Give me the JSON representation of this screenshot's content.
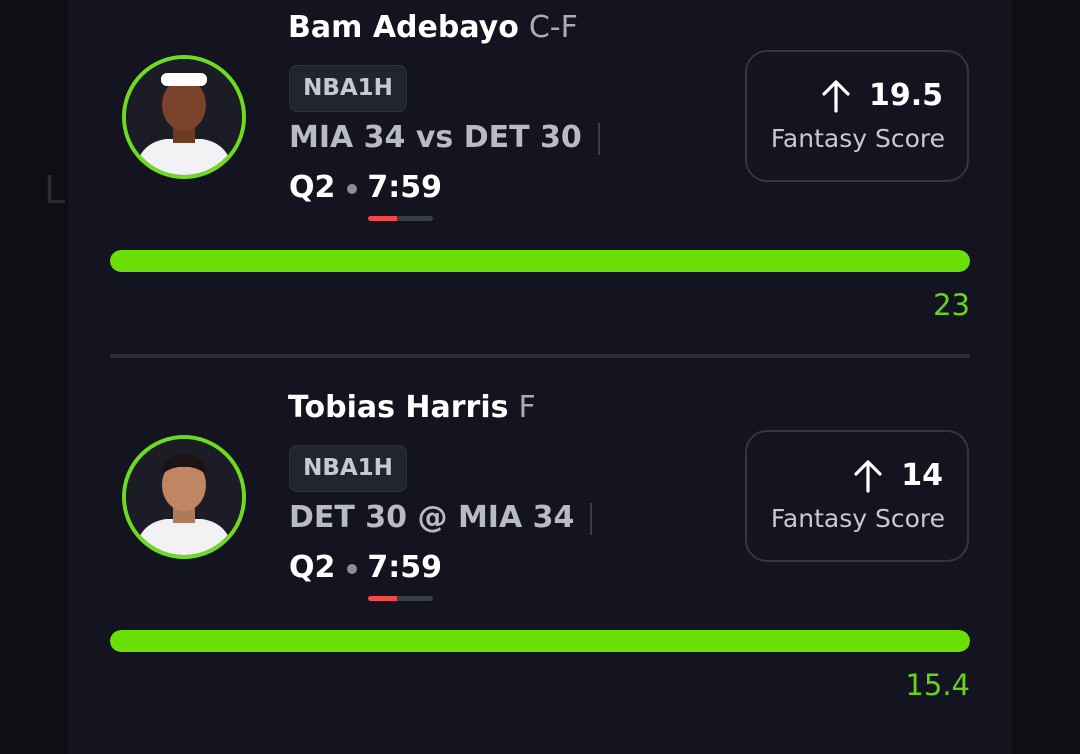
{
  "colors": {
    "accent_green": "#6ae006",
    "progress_red": "#f04949",
    "card_bg": "#13141f",
    "muted_text": "#a9abb5"
  },
  "background": {
    "left_letter": "L"
  },
  "players": [
    {
      "name": "Bam Adebayo",
      "position": "C-F",
      "league": "NBA1H",
      "matchup": "MIA 34 vs DET 30",
      "quarter": "Q2",
      "time": "7:59",
      "time_progress": 0.45,
      "line_value": "19.5",
      "direction_icon": "arrow-up-icon",
      "stat_label": "Fantasy Score",
      "actual_value": "23",
      "bar_progress": 1.0,
      "avatar_icon": "player-headshot-icon"
    },
    {
      "name": "Tobias Harris",
      "position": "F",
      "league": "NBA1H",
      "matchup": "DET 30 @ MIA 34",
      "quarter": "Q2",
      "time": "7:59",
      "time_progress": 0.45,
      "line_value": "14",
      "direction_icon": "arrow-up-icon",
      "stat_label": "Fantasy Score",
      "actual_value": "15.4",
      "bar_progress": 1.0,
      "avatar_icon": "player-headshot-icon"
    }
  ]
}
